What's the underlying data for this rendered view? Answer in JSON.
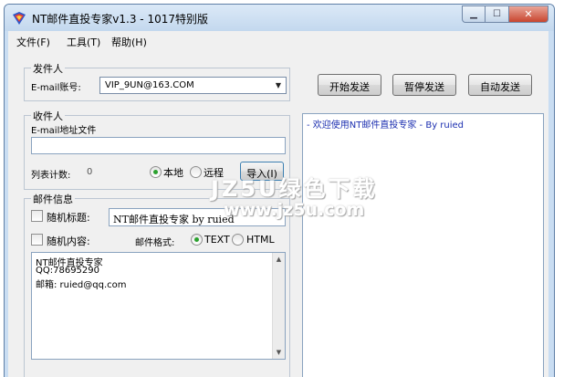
{
  "window": {
    "title": "NT邮件直投专家v1.3 - 1017特别版",
    "buttons": {
      "minimize": "▁",
      "maximize": "☐",
      "close": "✕"
    }
  },
  "menu": [
    {
      "label": "文件(F)"
    },
    {
      "label": "工具(T)"
    },
    {
      "label": "帮助(H)"
    }
  ],
  "sender": {
    "group_title": "发件人",
    "email_label": "E-mail账号:",
    "email_value": "VIP_9UN@163.COM",
    "arrow": "▼"
  },
  "recipient": {
    "group_title": "收件人",
    "file_label": "E-mail地址文件",
    "file_value": "",
    "count_label": "列表计数:",
    "count_value": "0",
    "local_label": "本地",
    "remote_label": "远程",
    "import_button": "导入(I)"
  },
  "mail_info": {
    "group_title": "邮件信息",
    "random_subject_label": "随机标题:",
    "subject_value": "NT邮件直投专家 by ruied",
    "random_content_label": "随机内容:",
    "format_label": "邮件格式:",
    "format_text": "TEXT",
    "format_html": "HTML",
    "content_lines": [
      "NT邮件直投专家",
      "QQ:78695290",
      "邮箱: ruied@qq.com"
    ]
  },
  "actions": {
    "start": "开始发送",
    "pause": "暂停发送",
    "auto": "自动发送"
  },
  "log": {
    "lines": [
      "- 欢迎使用NT邮件直投专家 - By ruied"
    ]
  },
  "watermark": {
    "main": "JZ5U绿色下载",
    "sub": "www.jz5u.com"
  },
  "colors": {
    "accent": "#2aa12e",
    "log_text": "#1c2fb0"
  }
}
